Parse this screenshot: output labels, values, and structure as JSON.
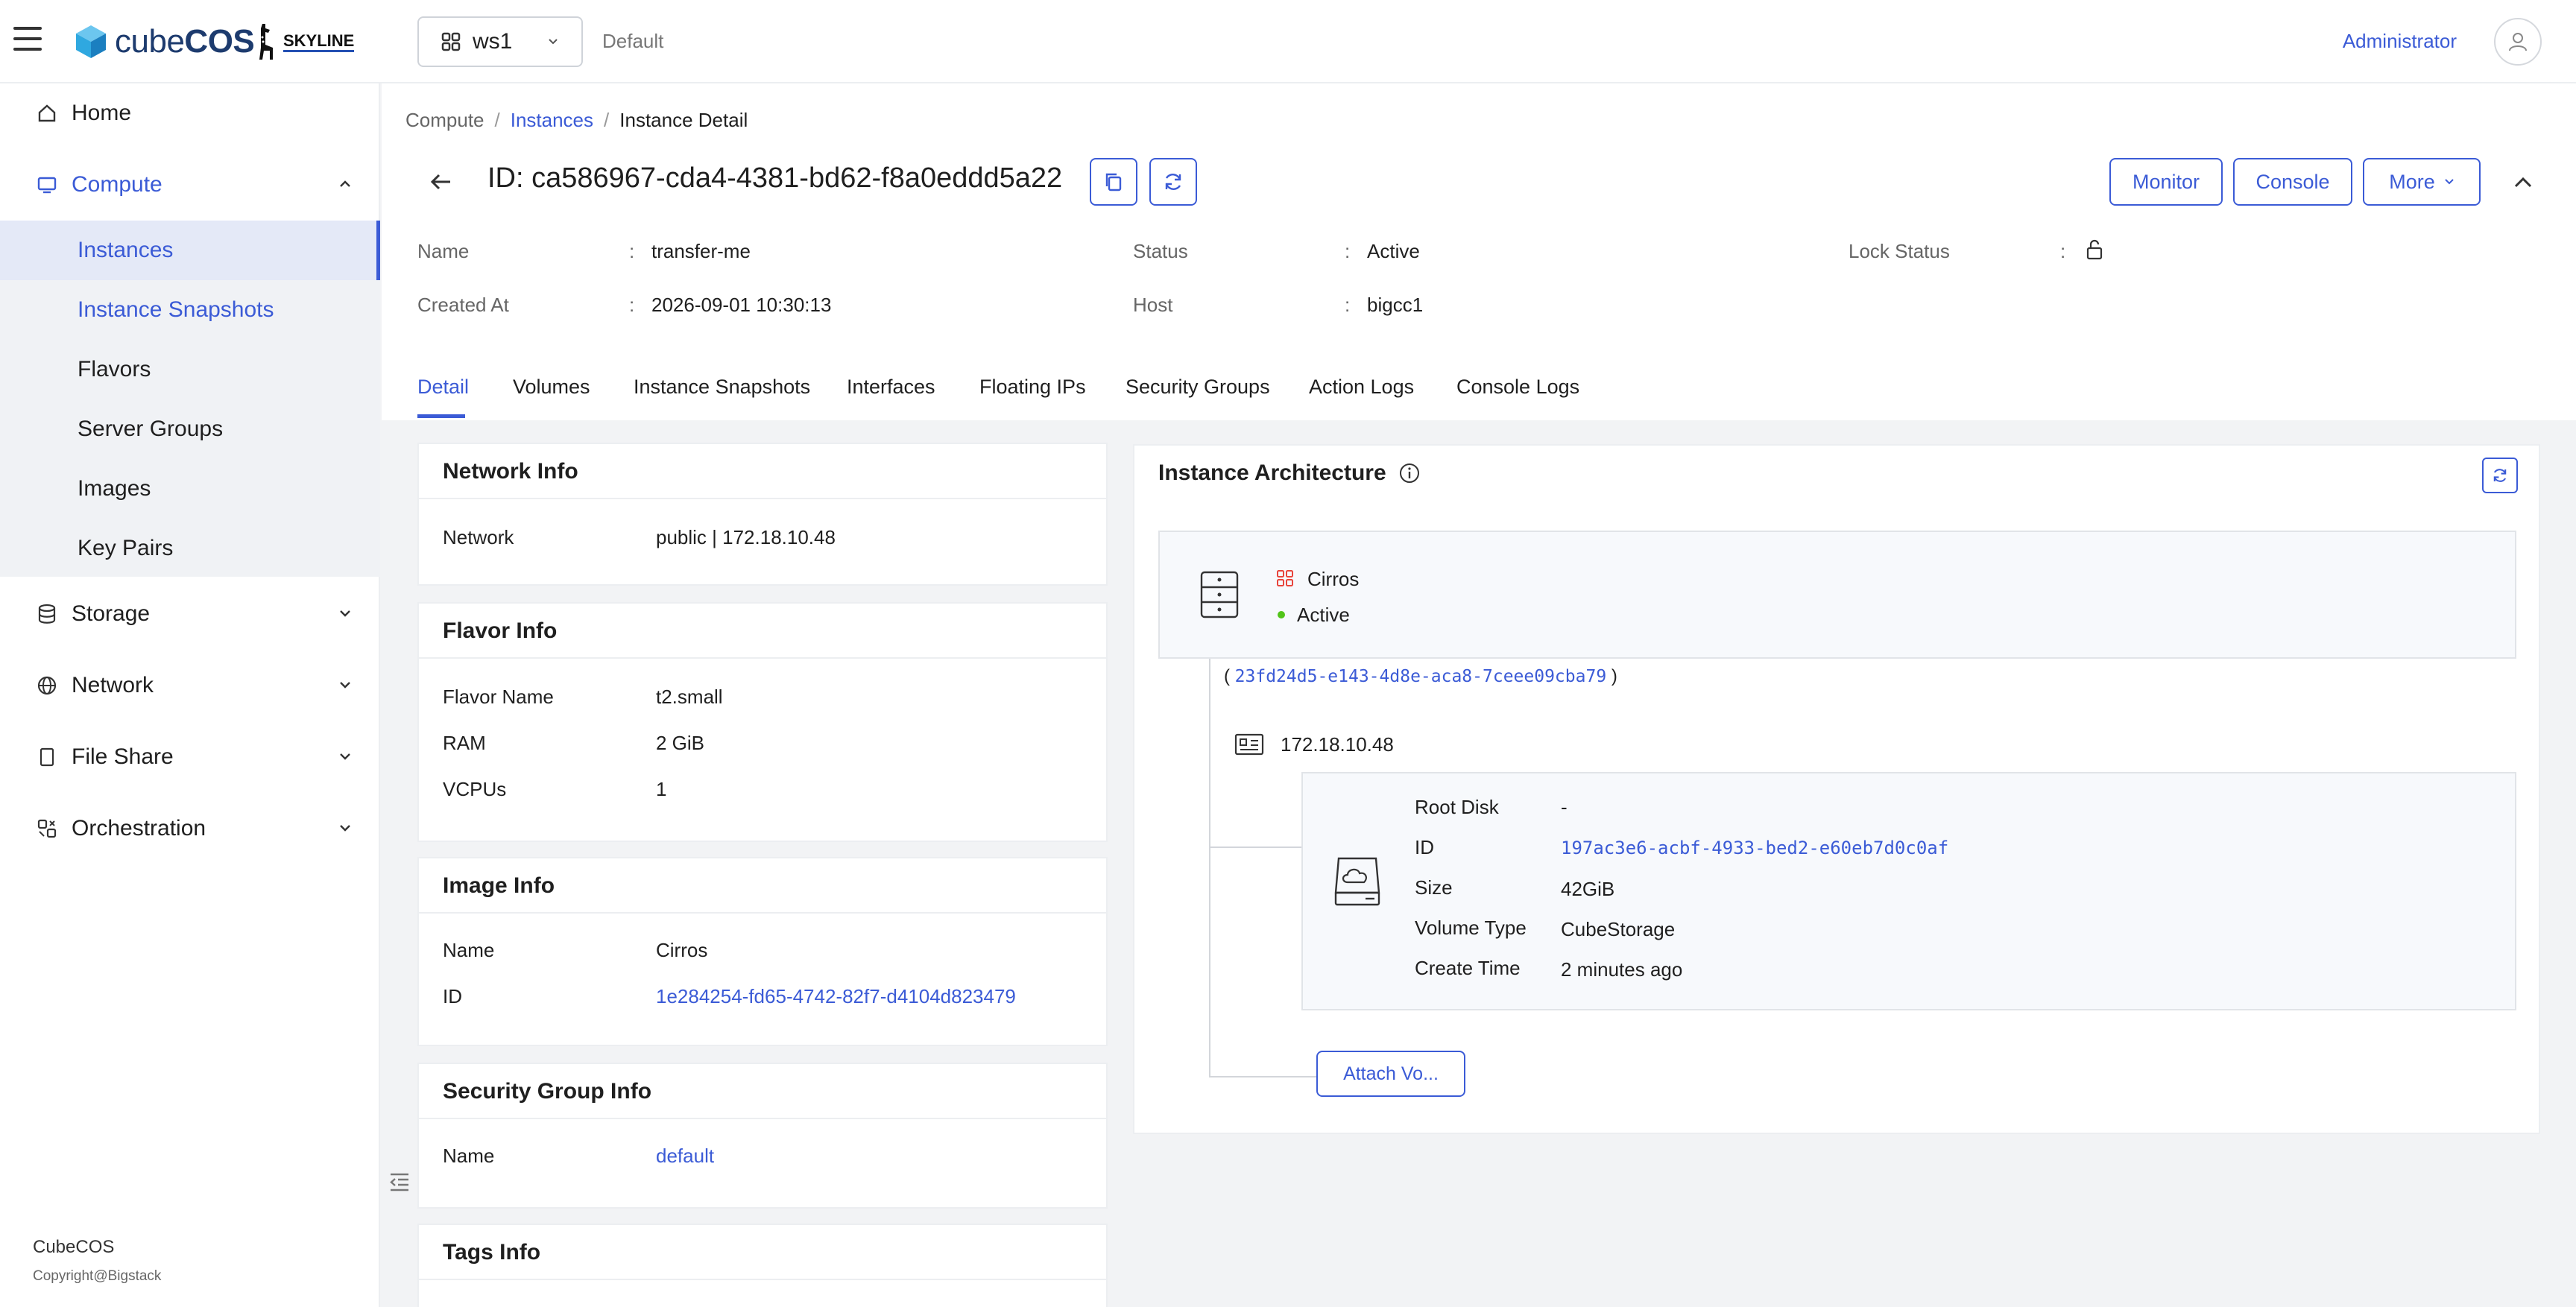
{
  "topbar": {
    "brand_light": "cube",
    "brand_bold": "COS",
    "skyline": "SKYLINE",
    "workspace": "ws1",
    "project": "Default",
    "user": "Administrator"
  },
  "sidebar": {
    "items": [
      {
        "label": "Home"
      },
      {
        "label": "Compute"
      },
      {
        "label": "Storage"
      },
      {
        "label": "Network"
      },
      {
        "label": "File Share"
      },
      {
        "label": "Orchestration"
      }
    ],
    "compute_sub": [
      {
        "label": "Instances"
      },
      {
        "label": "Instance Snapshots"
      },
      {
        "label": "Flavors"
      },
      {
        "label": "Server Groups"
      },
      {
        "label": "Images"
      },
      {
        "label": "Key Pairs"
      }
    ],
    "footer_title": "CubeCOS",
    "footer_copy": "Copyright@Bigstack"
  },
  "breadcrumb": {
    "root": "Compute",
    "parent": "Instances",
    "current": "Instance Detail"
  },
  "header": {
    "title_prefix": "ID:",
    "instance_id": "ca586967-cda4-4381-bd62-f8a0eddd5a22",
    "buttons": {
      "monitor": "Monitor",
      "console": "Console",
      "more": "More"
    }
  },
  "summary": {
    "name_label": "Name",
    "name_value": "transfer-me",
    "created_label": "Created At",
    "created_value": "2026-09-01 10:30:13",
    "status_label": "Status",
    "status_value": "Active",
    "host_label": "Host",
    "host_value": "bigcc1",
    "lock_label": "Lock Status",
    "colon": ":"
  },
  "tabs": [
    "Detail",
    "Volumes",
    "Instance Snapshots",
    "Interfaces",
    "Floating IPs",
    "Security Groups",
    "Action Logs",
    "Console Logs"
  ],
  "network_info": {
    "title": "Network Info",
    "network_label": "Network",
    "network_value": "public | 172.18.10.48"
  },
  "flavor_info": {
    "title": "Flavor Info",
    "name_label": "Flavor Name",
    "name_value": "t2.small",
    "ram_label": "RAM",
    "ram_value": "2 GiB",
    "vcpu_label": "VCPUs",
    "vcpu_value": "1"
  },
  "image_info": {
    "title": "Image Info",
    "name_label": "Name",
    "name_value": "Cirros",
    "id_label": "ID",
    "id_value": "1e284254-fd65-4742-82f7-d4104d823479"
  },
  "security_group_info": {
    "title": "Security Group Info",
    "name_label": "Name",
    "name_value": "default"
  },
  "tags_info": {
    "title": "Tags Info"
  },
  "architecture": {
    "title": "Instance Architecture",
    "image_name": "Cirros",
    "status": "Active",
    "port_open": "(",
    "port_id": "23fd24d5-e143-4d8e-aca8-7ceee09cba79",
    "port_close": ")",
    "ip": "172.18.10.48",
    "volume": {
      "root_label": "Root Disk",
      "root_value": "-",
      "id_label": "ID",
      "id_value": "197ac3e6-acbf-4933-bed2-e60eb7d0c0af",
      "size_label": "Size",
      "size_value": "42GiB",
      "type_label": "Volume Type",
      "type_value": "CubeStorage",
      "time_label": "Create Time",
      "time_value": "2 minutes ago"
    },
    "attach_label": "Attach Vo..."
  },
  "colors": {
    "accent": "#3b5bd6",
    "status_green": "#52c41a",
    "brand_cube": "#2fa8e0",
    "image_red": "#e8453c"
  }
}
